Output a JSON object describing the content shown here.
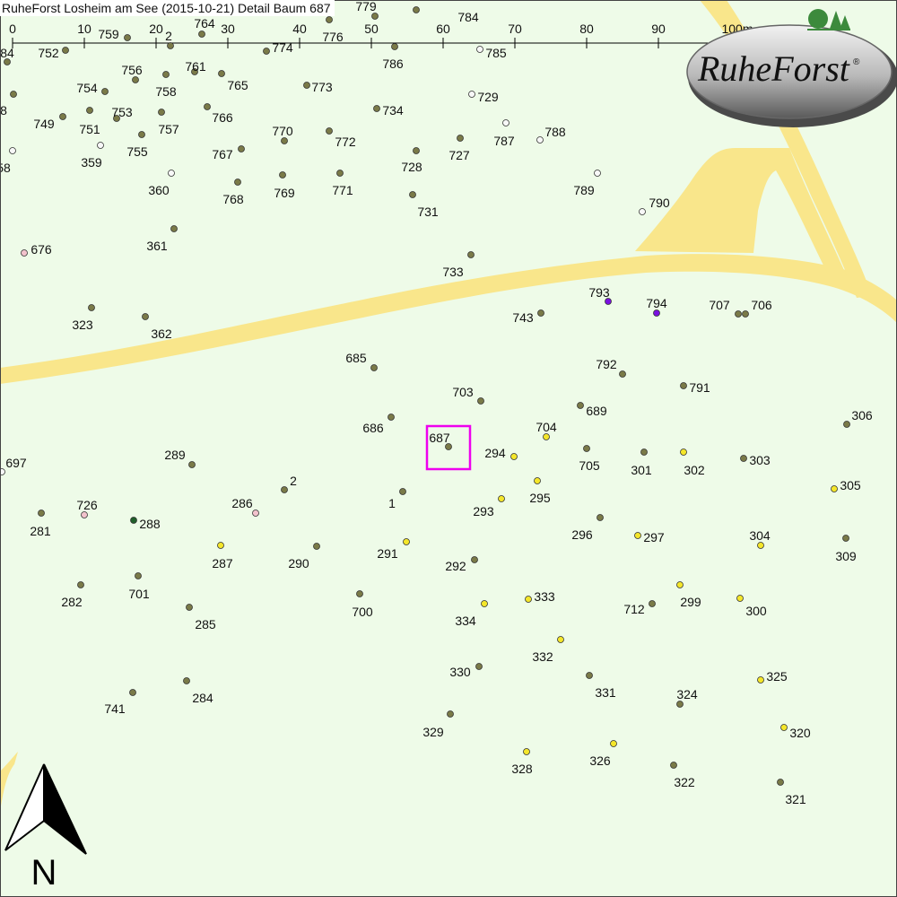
{
  "map": {
    "title": "RuheForst Losheim am See (2015-10-21) Detail  Baum 687",
    "background_color": "#eefbe8",
    "path_color": "#f9e68b",
    "selected_tree": "687",
    "highlight_color": "#ee00ee"
  },
  "scale_bar": {
    "ticks": [
      "0",
      "10",
      "20",
      "30",
      "40",
      "50",
      "60",
      "70",
      "80",
      "90",
      "100m"
    ]
  },
  "logo": {
    "text": "RuheForst",
    "registered_mark": "®"
  },
  "north_arrow": {
    "label": "N"
  },
  "legend_colors": {
    "olive": "#7a7a48",
    "yellow": "#f4e62a",
    "white": "#f8f8f8",
    "pink": "#f2c2cc",
    "purple": "#7a10e0",
    "darkgreen": "#1f5f2a"
  },
  "trees": [
    {
      "id": "752",
      "c": "olive"
    },
    {
      "id": "759",
      "c": "olive"
    },
    {
      "id": "2",
      "c": "olive"
    },
    {
      "id": "764",
      "c": "olive"
    },
    {
      "id": "774",
      "c": "olive"
    },
    {
      "id": "776",
      "c": "olive"
    },
    {
      "id": "779",
      "c": "olive"
    },
    {
      "id": "784",
      "c": "olive"
    },
    {
      "id": "786",
      "c": "olive"
    },
    {
      "id": "785",
      "c": "white"
    },
    {
      "id": "84",
      "c": "olive"
    },
    {
      "id": "756",
      "c": "olive"
    },
    {
      "id": "761",
      "c": "olive"
    },
    {
      "id": "758",
      "c": "olive"
    },
    {
      "id": "765",
      "c": "olive"
    },
    {
      "id": "773",
      "c": "olive"
    },
    {
      "id": "754",
      "c": "olive"
    },
    {
      "id": "729",
      "c": "white"
    },
    {
      "id": "8",
      "c": "olive"
    },
    {
      "id": "753",
      "c": "olive"
    },
    {
      "id": "749",
      "c": "olive"
    },
    {
      "id": "751",
      "c": "olive"
    },
    {
      "id": "757",
      "c": "olive"
    },
    {
      "id": "766",
      "c": "olive"
    },
    {
      "id": "734",
      "c": "olive"
    },
    {
      "id": "770",
      "c": "olive"
    },
    {
      "id": "772",
      "c": "olive"
    },
    {
      "id": "787",
      "c": "white"
    },
    {
      "id": "788",
      "c": "white"
    },
    {
      "id": "755",
      "c": "olive"
    },
    {
      "id": "359",
      "c": "white"
    },
    {
      "id": "58",
      "c": "white"
    },
    {
      "id": "767",
      "c": "olive"
    },
    {
      "id": "727",
      "c": "olive"
    },
    {
      "id": "728",
      "c": "olive"
    },
    {
      "id": "360",
      "c": "white"
    },
    {
      "id": "768",
      "c": "olive"
    },
    {
      "id": "769",
      "c": "olive"
    },
    {
      "id": "771",
      "c": "olive"
    },
    {
      "id": "789",
      "c": "white"
    },
    {
      "id": "731",
      "c": "olive"
    },
    {
      "id": "790",
      "c": "white"
    },
    {
      "id": "361",
      "c": "olive"
    },
    {
      "id": "676",
      "c": "pink"
    },
    {
      "id": "733",
      "c": "olive"
    },
    {
      "id": "793",
      "c": "purple"
    },
    {
      "id": "794",
      "c": "purple"
    },
    {
      "id": "707",
      "c": "olive"
    },
    {
      "id": "706",
      "c": "olive"
    },
    {
      "id": "323",
      "c": "olive"
    },
    {
      "id": "362",
      "c": "olive"
    },
    {
      "id": "743",
      "c": "olive"
    },
    {
      "id": "685",
      "c": "olive"
    },
    {
      "id": "792",
      "c": "olive"
    },
    {
      "id": "703",
      "c": "olive"
    },
    {
      "id": "791",
      "c": "olive"
    },
    {
      "id": "689",
      "c": "olive"
    },
    {
      "id": "306",
      "c": "olive"
    },
    {
      "id": "686",
      "c": "olive"
    },
    {
      "id": "704",
      "c": "yellow"
    },
    {
      "id": "687",
      "c": "olive"
    },
    {
      "id": "294",
      "c": "yellow"
    },
    {
      "id": "705",
      "c": "olive"
    },
    {
      "id": "301",
      "c": "olive"
    },
    {
      "id": "302",
      "c": "yellow"
    },
    {
      "id": "303",
      "c": "olive"
    },
    {
      "id": "697",
      "c": "white"
    },
    {
      "id": "289",
      "c": "olive"
    },
    {
      "id": "2b",
      "label": "2",
      "c": "olive"
    },
    {
      "id": "295",
      "c": "yellow"
    },
    {
      "id": "305",
      "c": "yellow"
    },
    {
      "id": "1",
      "c": "olive"
    },
    {
      "id": "286",
      "c": "pink"
    },
    {
      "id": "726",
      "c": "pink"
    },
    {
      "id": "293",
      "c": "yellow"
    },
    {
      "id": "288",
      "c": "darkgreen"
    },
    {
      "id": "281",
      "c": "olive"
    },
    {
      "id": "296",
      "c": "olive"
    },
    {
      "id": "297",
      "c": "yellow"
    },
    {
      "id": "304",
      "c": "yellow"
    },
    {
      "id": "287",
      "c": "yellow"
    },
    {
      "id": "290",
      "c": "olive"
    },
    {
      "id": "291",
      "c": "yellow"
    },
    {
      "id": "292",
      "c": "olive"
    },
    {
      "id": "309",
      "c": "olive"
    },
    {
      "id": "701",
      "c": "olive"
    },
    {
      "id": "282",
      "c": "olive"
    },
    {
      "id": "333",
      "c": "yellow"
    },
    {
      "id": "299",
      "c": "yellow"
    },
    {
      "id": "700",
      "c": "olive"
    },
    {
      "id": "334",
      "c": "yellow"
    },
    {
      "id": "712",
      "c": "olive"
    },
    {
      "id": "300",
      "c": "yellow"
    },
    {
      "id": "285",
      "c": "olive"
    },
    {
      "id": "332",
      "c": "yellow"
    },
    {
      "id": "330",
      "c": "olive"
    },
    {
      "id": "325",
      "c": "yellow"
    },
    {
      "id": "331",
      "c": "olive"
    },
    {
      "id": "324",
      "c": "olive"
    },
    {
      "id": "284",
      "c": "olive"
    },
    {
      "id": "741",
      "c": "olive"
    },
    {
      "id": "329",
      "c": "olive"
    },
    {
      "id": "320",
      "c": "yellow"
    },
    {
      "id": "326",
      "c": "yellow"
    },
    {
      "id": "328",
      "c": "yellow"
    },
    {
      "id": "322",
      "c": "olive"
    },
    {
      "id": "321",
      "c": "olive"
    }
  ]
}
